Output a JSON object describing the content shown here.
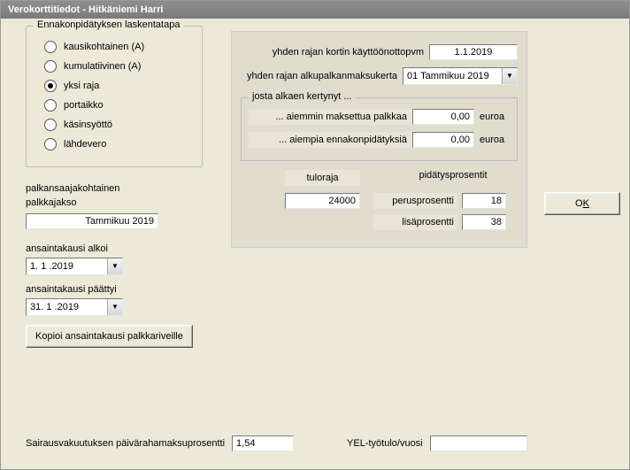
{
  "window": {
    "title": "Verokorttitiedot - Hitkäniemi Harri"
  },
  "radio": {
    "legend": "Ennakonpidätyksen laskentatapa",
    "items": [
      {
        "label": "kausikohtainen (A)",
        "selected": false
      },
      {
        "label": "kumulatiivinen (A)",
        "selected": false
      },
      {
        "label": "yksi raja",
        "selected": true
      },
      {
        "label": "portaikko",
        "selected": false
      },
      {
        "label": "käsinsyöttö",
        "selected": false
      },
      {
        "label": "lähdevero",
        "selected": false
      }
    ]
  },
  "panel": {
    "row1_label": "yhden rajan kortin käyttöönottopvm",
    "row1_value": "1.1.2019",
    "row2_label": "yhden rajan alkupalkanmaksukerta",
    "row2_value": "01 Tammikuu 2019",
    "inner_legend": " josta alkaen kertynyt ...",
    "inner1_label": "... aiemmin maksettua palkkaa",
    "inner1_value": "0,00",
    "inner2_label": "... aiempia ennakonpidätyksiä",
    "inner2_value": "0,00",
    "unit": "euroa",
    "tuloraja_label": "tuloraja",
    "tuloraja_value": "24000",
    "pidatys_header": "pidätysprosentit",
    "perus_label": "perusprosentti",
    "perus_value": "18",
    "lisa_label": "lisäprosentti",
    "lisa_value": "38"
  },
  "left": {
    "palkansaaja1": "palkansaajakohtainen",
    "palkansaaja2": "palkkajakso",
    "palkkajakso_value": "Tammikuu 2019",
    "alkoi_label": "ansaintakausi alkoi",
    "alkoi_value": "1. 1 .2019",
    "paattyi_label": "ansaintakausi päättyi",
    "paattyi_value": "31. 1 .2019",
    "kopioi_btn": "Kopioi ansaintakausi palkkariveille"
  },
  "bottom": {
    "sair_label": "Sairausvakuutuksen päivärahamaksuprosentti",
    "sair_value": "1,54",
    "yel_label": "YEL-työtulo/vuosi",
    "yel_value": ""
  },
  "ok": {
    "pre": "O",
    "accel": "K"
  }
}
